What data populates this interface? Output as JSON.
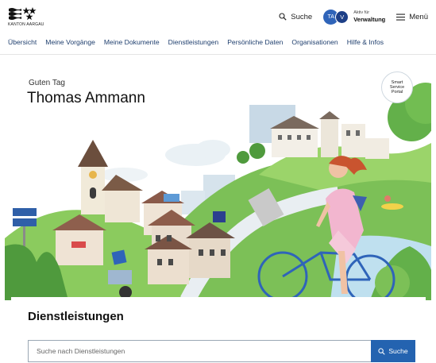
{
  "header": {
    "logo_text": "KANTON AARGAU",
    "search_label": "Suche",
    "avatar_initials": "TA",
    "role_initial": "V",
    "role_caption": "Aktiv für",
    "role_name": "Verwaltung",
    "menu_label": "Menü"
  },
  "nav": {
    "items": [
      "Übersicht",
      "Meine Vorgänge",
      "Meine Dokumente",
      "Dienstleistungen",
      "Persönliche Daten",
      "Organisationen",
      "Hilfe & Infos"
    ]
  },
  "hero": {
    "greeting": "Guten Tag",
    "user_name": "Thomas Ammann",
    "badge_line1": "Smart",
    "badge_line2": "Service",
    "badge_line3": "Portal",
    "sign_line1": "AARGAU",
    "sign_line2": "AARGAU"
  },
  "services": {
    "title": "Dienstleistungen",
    "search_placeholder": "Suche nach Dienstleistungen",
    "search_button": "Suche"
  },
  "colors": {
    "brand_blue": "#2463b0",
    "nav_text": "#1f3f6e",
    "avatar_blue": "#2f64b9"
  }
}
